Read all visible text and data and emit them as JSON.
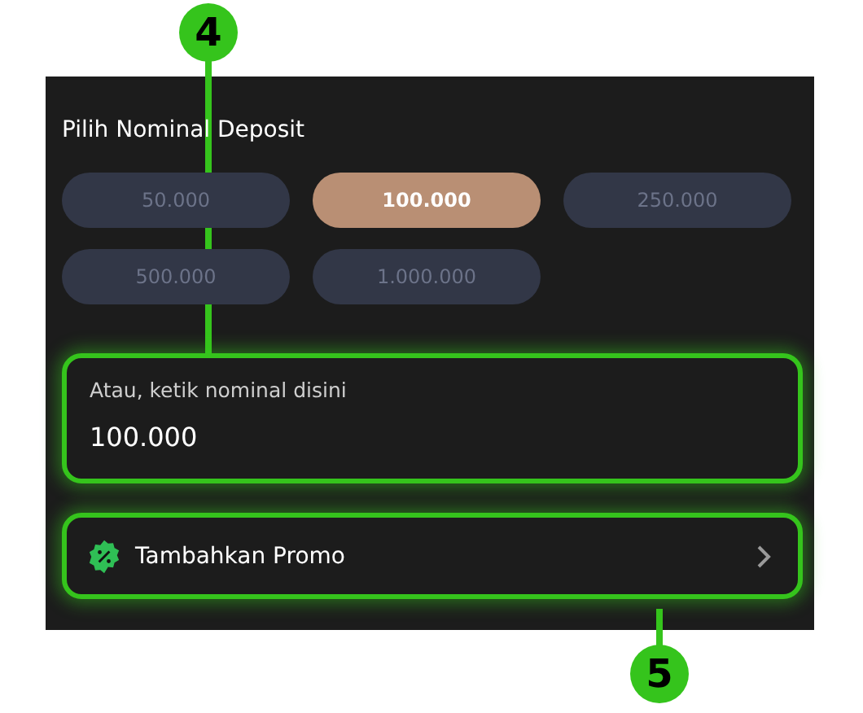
{
  "deposit": {
    "title": "Pilih Nominal Deposit",
    "amounts": [
      {
        "label": "50.000",
        "selected": false
      },
      {
        "label": "100.000",
        "selected": true
      },
      {
        "label": "250.000",
        "selected": false
      },
      {
        "label": "500.000",
        "selected": false
      },
      {
        "label": "1.000.000",
        "selected": false
      }
    ],
    "amount_field": {
      "label": "Atau, ketik nominal disini",
      "value": "100.000",
      "highlighted": true
    },
    "promo_button": {
      "label": "Tambahkan Promo",
      "highlighted": true
    }
  },
  "callouts": [
    {
      "label": "4"
    },
    {
      "label": "5"
    }
  ]
}
